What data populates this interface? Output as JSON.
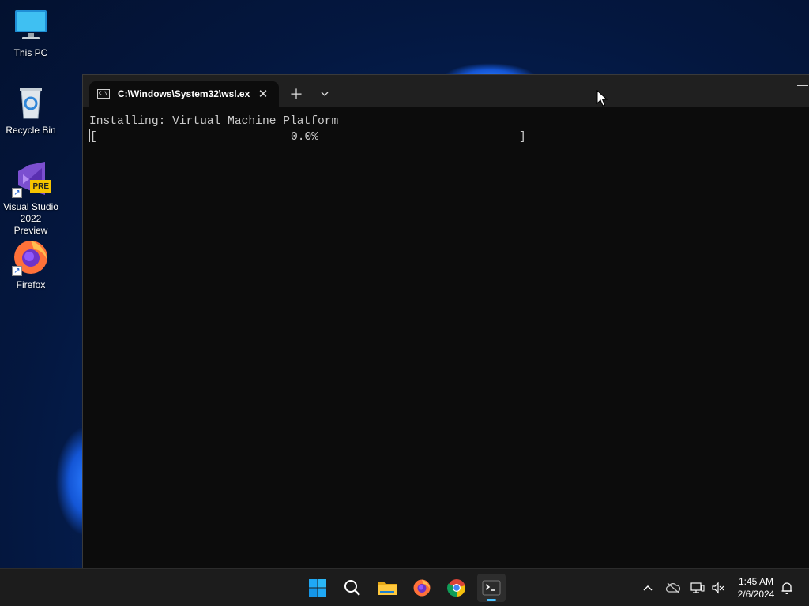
{
  "desktop": {
    "icons": [
      {
        "label": "This PC",
        "icon": "monitor-icon"
      },
      {
        "label": "Recycle Bin",
        "icon": "recycle-bin-icon"
      },
      {
        "label": "Visual Studio 2022 Preview",
        "icon": "visual-studio-preview-icon",
        "badge": "PRE"
      },
      {
        "label": "Firefox",
        "icon": "firefox-icon"
      }
    ]
  },
  "terminal": {
    "tab_title": "C:\\Windows\\System32\\wsl.ex",
    "cmd_icon_text": "C:\\",
    "lines": [
      "Installing: Virtual Machine Platform",
      "                            0.0%                             ]"
    ],
    "progress_percent": 0.0,
    "progress_open_bracket": "["
  },
  "taskbar": {
    "apps": [
      {
        "name": "start",
        "icon": "windows-start-icon"
      },
      {
        "name": "search",
        "icon": "search-icon"
      },
      {
        "name": "file-explorer",
        "icon": "folder-icon"
      },
      {
        "name": "firefox",
        "icon": "firefox-icon"
      },
      {
        "name": "chrome",
        "icon": "chrome-icon"
      },
      {
        "name": "terminal",
        "icon": "terminal-icon",
        "active": true
      }
    ],
    "tray": {
      "time": "1:45 AM",
      "date": "2/6/2024"
    }
  },
  "colors": {
    "accent": "#4cc2ff",
    "terminal_bg": "#0c0c0c",
    "terminal_text": "#cccccc",
    "tabbar_bg": "#202020",
    "taskbar_bg": "#1c1c1c"
  }
}
